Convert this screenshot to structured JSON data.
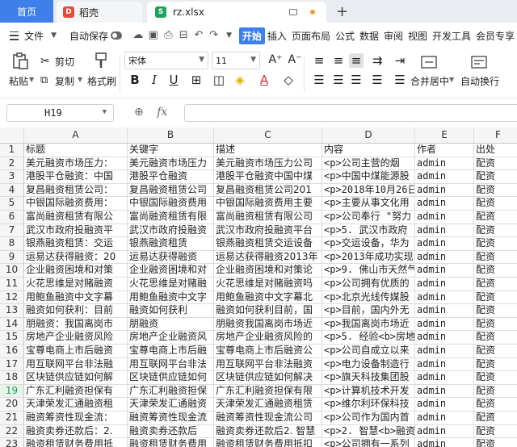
{
  "tabs": {
    "home": "首页",
    "docer": "稻壳",
    "docer_logo": "D",
    "file": "rz.xlsx",
    "file_logo": "S"
  },
  "menu": {
    "file": "文件",
    "autosave": "自动保存",
    "items": [
      "开始",
      "插入",
      "页面布局",
      "公式",
      "数据",
      "审阅",
      "视图",
      "开发工具",
      "会员专享"
    ]
  },
  "ribbon": {
    "paste": "粘贴",
    "cut": "剪切",
    "copy": "复制",
    "format_painter": "格式刷",
    "font_name": "宋体",
    "font_size": "11",
    "merge_center": "合并居中",
    "auto_wrap": "自动换行"
  },
  "formula_bar": {
    "cell_ref": "H19",
    "fx": "fx",
    "content": ""
  },
  "sheet": {
    "columns": [
      "A",
      "B",
      "C",
      "D",
      "E",
      "F"
    ],
    "selected_row": 19,
    "rows": [
      [
        "1",
        "标题",
        "关键字",
        "描述",
        "内容",
        "作者",
        "出处"
      ],
      [
        "2",
        "美元融资市场压力：",
        "美元融资市场压力",
        "美元融资市场压力公司",
        "<p>公司主营的烟",
        "admin",
        "配资"
      ],
      [
        "3",
        "港股平仓融资：中国",
        "港股平仓融资",
        "港股平仓融资中国中煤",
        "<p>中国中煤能源股",
        "admin",
        "配资"
      ],
      [
        "4",
        "复昌融资租赁公司：",
        "复昌融资租赁公司",
        "复昌融资租赁公司201",
        "<p>2018年10月26日",
        "admin",
        "配资"
      ],
      [
        "5",
        "中银国际融资费用：",
        "中银国际融资费用",
        "中银国际融资费用主要",
        "<p>主要从事文化用",
        "admin",
        "配资"
      ],
      [
        "6",
        "富尚融资租赁有限公",
        "富尚融资租赁有限",
        "富尚融资租赁有限公司",
        "<p>公司奉行 \"努力",
        "admin",
        "配资"
      ],
      [
        "7",
        "武汉市政府投融资平",
        "武汉市政府投融资",
        "武汉市政府投融资平台",
        "<p>5. 武汉市政府",
        "admin",
        "配资"
      ],
      [
        "8",
        "银燕融资租赁：交运",
        "银燕融资租赁",
        "银燕融资租赁交运设备",
        "<p>交运设备，华为",
        "admin",
        "配资"
      ],
      [
        "9",
        "运易达获得融资：20",
        "运易达获得融资",
        "运易达获得融资2013年",
        "<p>2013年成功实现",
        "admin",
        "配资"
      ],
      [
        "10",
        "企业融资困境和对策",
        "企业融资困境和对",
        "企业融资困境和对策论",
        "<p>9. 佛山市天然气",
        "admin",
        "配资"
      ],
      [
        "11",
        "火花思维是对赌融资",
        "火花思维是对赌融",
        "火花思维是对赌融资吗",
        "<p>公司拥有优质的",
        "admin",
        "配资"
      ],
      [
        "12",
        "用鲍鱼融资中文字幕",
        "用鲍鱼融资中文字",
        "用鲍鱼融资中文字幕北",
        "<p>北京光线传媒股",
        "admin",
        "配资"
      ],
      [
        "13",
        "融资如何获利：目前",
        "融资如何获利",
        "融资如何获利目前，国",
        "<p>目前，国内外无",
        "admin",
        "配资"
      ],
      [
        "14",
        "朋融资：我国离岗市",
        "朋融资",
        "朋融资我国离岗市场近",
        "<p>我国离岗市场近",
        "admin",
        "配资"
      ],
      [
        "15",
        "房地产企业融资风险",
        "房地产企业融资风",
        "房地产企业融资风险的",
        "<p>5. 经验<b>房地",
        "admin",
        "配资"
      ],
      [
        "16",
        "宝尊电商上市后融资",
        "宝尊电商上市后融",
        "宝尊电商上市后融资公",
        "<p>公司自成立以来",
        "admin",
        "配资"
      ],
      [
        "17",
        "用互联网平台非法融",
        "用互联网平台非法",
        "用互联网平台非法融资",
        "<p>电力设备制造行",
        "admin",
        "配资"
      ],
      [
        "18",
        "区块链供应链如何解",
        "区块链供应链如何",
        "区块链供应链如何解决",
        "<p>旗天科技集团股",
        "admin",
        "配资"
      ],
      [
        "19",
        "广东汇利融资担保有",
        "广东汇利融资担保",
        "广东汇利融资担保有限",
        "<p>计算机技术开发",
        "admin",
        "配资"
      ],
      [
        "20",
        "天津荣发汇通融资租",
        "天津荣发汇通融资",
        "天津荣发汇通融资租赁",
        "<p>维尔利环保科技",
        "admin",
        "配资"
      ],
      [
        "21",
        "融资筹资性现金流：",
        "融资筹资性现金流",
        "融资筹资性现金流公司",
        "<p>公司作为国内首",
        "admin",
        "配资"
      ],
      [
        "22",
        "融资卖券还款后：2.",
        "融资卖券还款后",
        "融资卖券还款后2. 智慧",
        "<p>2. 智慧<b>融资",
        "admin",
        "配资"
      ],
      [
        "23",
        "融资租赁财务费用抵",
        "融资租赁财务费用",
        "融资租赁财务费用抵扣",
        "<p>公司拥有一系列",
        "admin",
        "配资"
      ]
    ]
  }
}
